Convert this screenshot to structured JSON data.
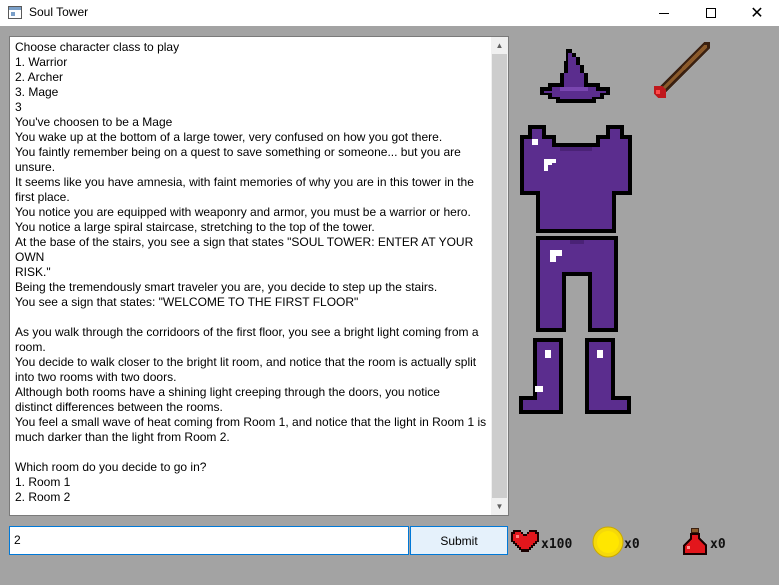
{
  "window": {
    "title": "Soul Tower",
    "controls": [
      "minimize",
      "maximize",
      "close"
    ]
  },
  "story": {
    "lines": [
      "Choose character class to play",
      "1. Warrior",
      "2. Archer",
      "3. Mage",
      "3",
      "You've choosen to be a Mage",
      "You wake up at the bottom of a large tower, very confused on how you got there.",
      "You faintly remember being on a quest to save something or someone... but you are",
      "unsure.",
      "It seems like you have amnesia, with faint memories of why you are in this tower in the",
      "first place.",
      "You notice you are equipped with weaponry and armor, you must be a warrior or hero.",
      "You notice a large spiral staircase, stretching to the top of the tower.",
      "At the base of the stairs, you see a sign that states \"SOUL TOWER: ENTER AT YOUR OWN",
      "RISK.\"",
      "Being the tremendously smart traveler you are, you decide to step up the stairs.",
      "You see a sign that states: \"WELCOME TO THE FIRST FLOOR\"",
      "",
      "As you walk through the corridoors of the first floor, you see a bright light coming from a",
      "room.",
      "You decide to walk closer to the bright lit room, and notice that the room is actually split",
      "into two rooms with two doors.",
      "Although both rooms have a shining light creeping through the doors, you notice",
      "distinct differences between the rooms.",
      "You feel a small wave of heat coming from Room 1, and notice that the light in Room 1 is",
      "much darker than the light from Room 2.",
      "",
      "Which room do you decide to go in?",
      "1. Room 1",
      "2. Room 2"
    ]
  },
  "input": {
    "value": "2",
    "submit_label": "Submit"
  },
  "stats": {
    "health_label": "x100",
    "coins_label": "x0",
    "potions_label": "x0"
  },
  "icons": {
    "hat": "wizard-hat-icon",
    "wand": "wand-icon",
    "chest": "chest-armor-icon",
    "legs": "leg-armor-icon",
    "boots": "boots-icon",
    "heart": "heart-icon",
    "coin": "coin-icon",
    "potion": "potion-icon"
  },
  "colors": {
    "armor_purple": "#5b2d8e",
    "armor_outline": "#000000",
    "background": "#a3a3a3",
    "accent": "#0078d7"
  }
}
